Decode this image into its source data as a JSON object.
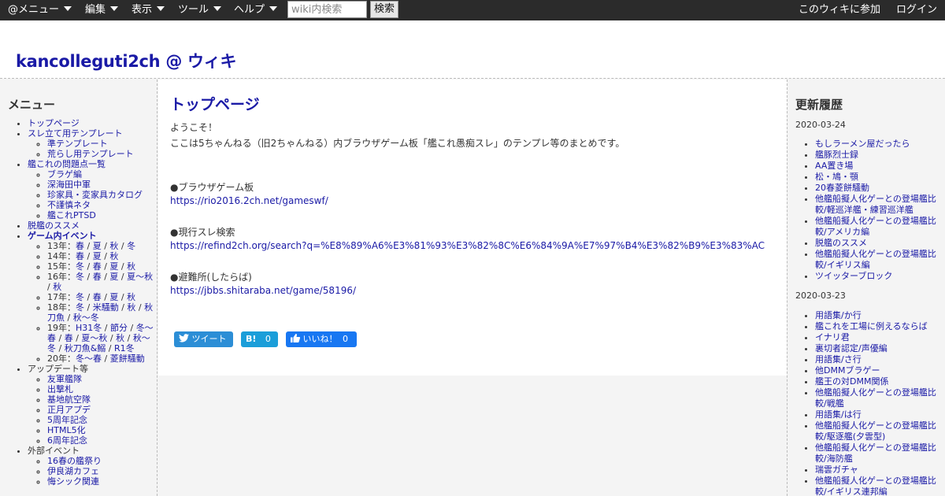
{
  "toolbar": {
    "menu_label": "@メニュー",
    "edit_label": "編集",
    "view_label": "表示",
    "tools_label": "ツール",
    "help_label": "ヘルプ",
    "search_placeholder": "wiki内検索",
    "search_button": "検索",
    "join_label": "このウィキに参加",
    "login_label": "ログイン"
  },
  "site": {
    "title": "kancolleguti2ch @ ウィキ"
  },
  "sidebar": {
    "heading": "メニュー",
    "items": [
      {
        "label": "トップページ",
        "link": true
      },
      {
        "label": "スレ立て用テンプレート",
        "link": true,
        "children": [
          {
            "label": "準テンプレート"
          },
          {
            "label": "荒らし用テンプレート"
          }
        ]
      },
      {
        "label": "艦これの問題点一覧",
        "link": true,
        "children": [
          {
            "label": "ブラゲ編"
          },
          {
            "label": "深海田中軍"
          },
          {
            "label": "珍家具・変家具カタログ"
          },
          {
            "label": "不謹慎ネタ"
          },
          {
            "label": "艦これPTSD"
          }
        ]
      },
      {
        "label": "脱艦のススメ",
        "link": true
      },
      {
        "label": "ゲーム内イベント",
        "link": true,
        "bold": true
      }
    ],
    "events": [
      {
        "year": "13年：",
        "parts": [
          "春",
          "夏",
          "秋",
          "冬"
        ]
      },
      {
        "year": "14年：",
        "parts": [
          "春",
          "夏",
          "秋"
        ]
      },
      {
        "year": "15年：",
        "parts": [
          "冬",
          "春",
          "夏",
          "秋"
        ]
      },
      {
        "year": "16年：",
        "parts": [
          "冬",
          "春",
          "夏",
          "夏～秋",
          "秋"
        ]
      },
      {
        "year": "17年：",
        "parts": [
          "冬",
          "春",
          "夏",
          "秋"
        ]
      },
      {
        "year": "18年：",
        "parts": [
          "冬",
          "米騒動",
          "秋",
          "秋刀魚",
          "秋〜冬"
        ]
      },
      {
        "year": "19年：",
        "parts": [
          "H31冬",
          "節分",
          "冬〜春",
          "春",
          "夏〜秋",
          "秋",
          "秋～冬",
          "秋刀魚&鰯",
          "R1冬"
        ]
      },
      {
        "year": "20年：",
        "parts": [
          "冬〜春",
          "菱餅騒動"
        ]
      }
    ],
    "update_heading": "アップデート等",
    "updates": [
      "友軍艦隊",
      "出撃札",
      "基地航空隊",
      "正月アプデ",
      "5周年記念",
      "HTML5化",
      "6周年記念"
    ],
    "external_heading": "外部イベント",
    "externals": [
      "16春の艦祭り",
      "伊良湖カフェ",
      "悔シック関連"
    ]
  },
  "main": {
    "title": "トップページ",
    "welcome": "ようこそ！",
    "intro": "ここは5ちゃんねる（旧2ちゃんねる）内ブラウザゲーム板「艦これ愚痴スレ」のテンプレ等のまとめです。",
    "board_label": "●ブラウザゲーム板",
    "board_url": "https://rio2016.2ch.net/gameswf/",
    "search_label": "●現行スレ検索",
    "search_url": "https://refind2ch.org/search?q=%E8%89%A6%E3%81%93%E3%82%8C%E6%84%9A%E7%97%B4%E3%82%B9%E3%83%AC",
    "refuge_label": "●避難所(したらば)",
    "refuge_url": "https://jbbs.shitaraba.net/game/58196/",
    "tweet_label": "ツイート",
    "hatena_icon": "B!",
    "hatena_count": "0",
    "like_label": "いいね！",
    "like_count": "0"
  },
  "recent": {
    "heading": "更新履歴",
    "groups": [
      {
        "date": "2020-03-24",
        "items": [
          "もしラーメン屋だったら",
          "艦豚烈士録",
          "AA置き場",
          "松・鳩・顎",
          "20春菱餅騒動",
          "他艦船擬人化ゲーとの登場艦比較/軽巡洋艦・練習巡洋艦",
          "他艦船擬人化ゲーとの登場艦比較/アメリカ編",
          "脱艦のススメ",
          "他艦船擬人化ゲーとの登場艦比較/イギリス編",
          "ツイッターブロック"
        ]
      },
      {
        "date": "2020-03-23",
        "items": [
          "用語集/か行",
          "艦これを工場に例えるならば",
          "イナリ君",
          "裏切者認定/声優編",
          "用語集/さ行",
          "他DMMブラゲー",
          "艦王の対DMM関係",
          "他艦船擬人化ゲーとの登場艦比較/戦艦",
          "用語集/は行",
          "他艦船擬人化ゲーとの登場艦比較/駆逐艦(夕雲型)",
          "他艦船擬人化ゲーとの登場艦比較/海防艦",
          "瑞雲ガチャ",
          "他艦船擬人化ゲーとの登場艦比較/イギリス連邦編"
        ]
      }
    ]
  }
}
